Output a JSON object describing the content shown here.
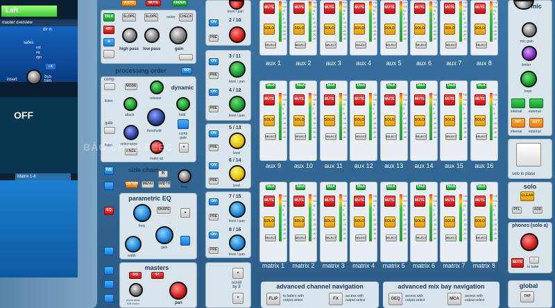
{
  "screen": {
    "tab_label": "Left",
    "master_overview": "master overview",
    "dir_in": "dir in",
    "safes": "safes",
    "ext": "ext",
    "eq": "eq",
    "dyn": "dyn",
    "lk": "LK",
    "insert": "insert",
    "bus_trim": "bus\ntrim",
    "off": "OFF",
    "matrix_label": "Matrix 1-8"
  },
  "top_strip": {
    "auto": "AUTO",
    "mute": "MUTE",
    "fader": "FADER"
  },
  "channel": {
    "talk": "TALK",
    "v48": "48V",
    "phase": "⊘",
    "slope1": "SLOPE",
    "slope2": "SLOPE",
    "meter": "meter",
    "check": "CHECK",
    "high_pass": "high pass",
    "low_pass": "low pass",
    "gain": "gain",
    "processing_order": "processing order",
    "go": "GO",
    "comp": "comp",
    "listen": "listen",
    "gate": "gate",
    "listen2": "listen",
    "mode": "MODE",
    "release": "release",
    "dynamic": "dynamic",
    "attack": "attack",
    "hold": "hold",
    "threshold": "threshold",
    "comp_gate": "comp\ngate",
    "ratio_range": "ratio/range",
    "knee": "KNEE",
    "make_up": "make up",
    "ins": "INS",
    "side_chain": "side chain",
    "listen_btn": "LISTEN",
    "menu": "MENU",
    "width_btn": "WIDTH",
    "freq": "freq",
    "eq": "EQ",
    "parametric_eq": "parametric EQ",
    "shape": "SHAPE",
    "freq2": "freq",
    "gain2": "gain",
    "width": "width",
    "masters": "masters",
    "sis": "SIS",
    "st": "ST",
    "mono_level": "mono level\nSIS mono",
    "pan": "pan"
  },
  "stereo_column": {
    "label_top": "level / pan",
    "ch_2_10": "2 / 10",
    "ch_3_11": "3 / 11",
    "ch_4_12": "4 / 12",
    "ch_5_13": "5 / 13",
    "ch_6_14": "6 / 14",
    "ch_7_15": "7 / 15",
    "ch_8_16": "8 / 16",
    "level_pan": "level / pan",
    "level": "level",
    "on": "ON",
    "pre": "PRE",
    "scroll": "scroll\nby 8"
  },
  "bus_rows": {
    "talk": "TALK",
    "mute": "MUTE",
    "solo": "SOLO",
    "select": "SELECT",
    "row1": [
      "aux 1",
      "aux 2",
      "aux 3",
      "aux 4",
      "aux 5",
      "aux 6",
      "aux 7",
      "aux 8"
    ],
    "row2": [
      "aux 9",
      "aux 10",
      "aux 11",
      "aux 12",
      "aux 13",
      "aux 14",
      "aux 15",
      "aux 16"
    ],
    "row3": [
      "matrix 1",
      "matrix 2",
      "matrix 3",
      "matrix 4",
      "matrix 5",
      "matrix 6",
      "matrix 7",
      "matrix 8"
    ],
    "scale": [
      "+15",
      "+10",
      "+5",
      "0",
      "-5",
      "-10",
      "-15",
      "-20",
      "-30",
      "-40"
    ]
  },
  "navigation": {
    "adv_channel": "advanced channel navigation",
    "flip": "FLIP",
    "flip_desc": "to faders with\noutput select",
    "fx": "FX",
    "fx_desc": "access with\noutput select",
    "adv_mixbay": "advanced mix bay navigation",
    "geq": "GEQ",
    "geq_desc": "access with\noutput select",
    "mca": "MCA",
    "mca_desc": "access with\noutput select",
    "global": "global",
    "tap": "TAP"
  },
  "right_panel": {
    "talk_mic": "talk mic",
    "mic_gain": "mic gain",
    "limiter": "limiter",
    "level": "level",
    "internal": "internal",
    "external": "external",
    "int_btn": "INT",
    "ext_btn": "EXT",
    "internal2": "internal",
    "external2": "external",
    "solo_in_place": "solo in place",
    "solo": "solo",
    "clear": "CLEAR",
    "pfl": "PFL",
    "add": "ADD",
    "phones": "phones (solo a)",
    "mute": "MUTE",
    "to_fader": "to fader"
  },
  "watermark": "BẢO CHÂU ELEC"
}
